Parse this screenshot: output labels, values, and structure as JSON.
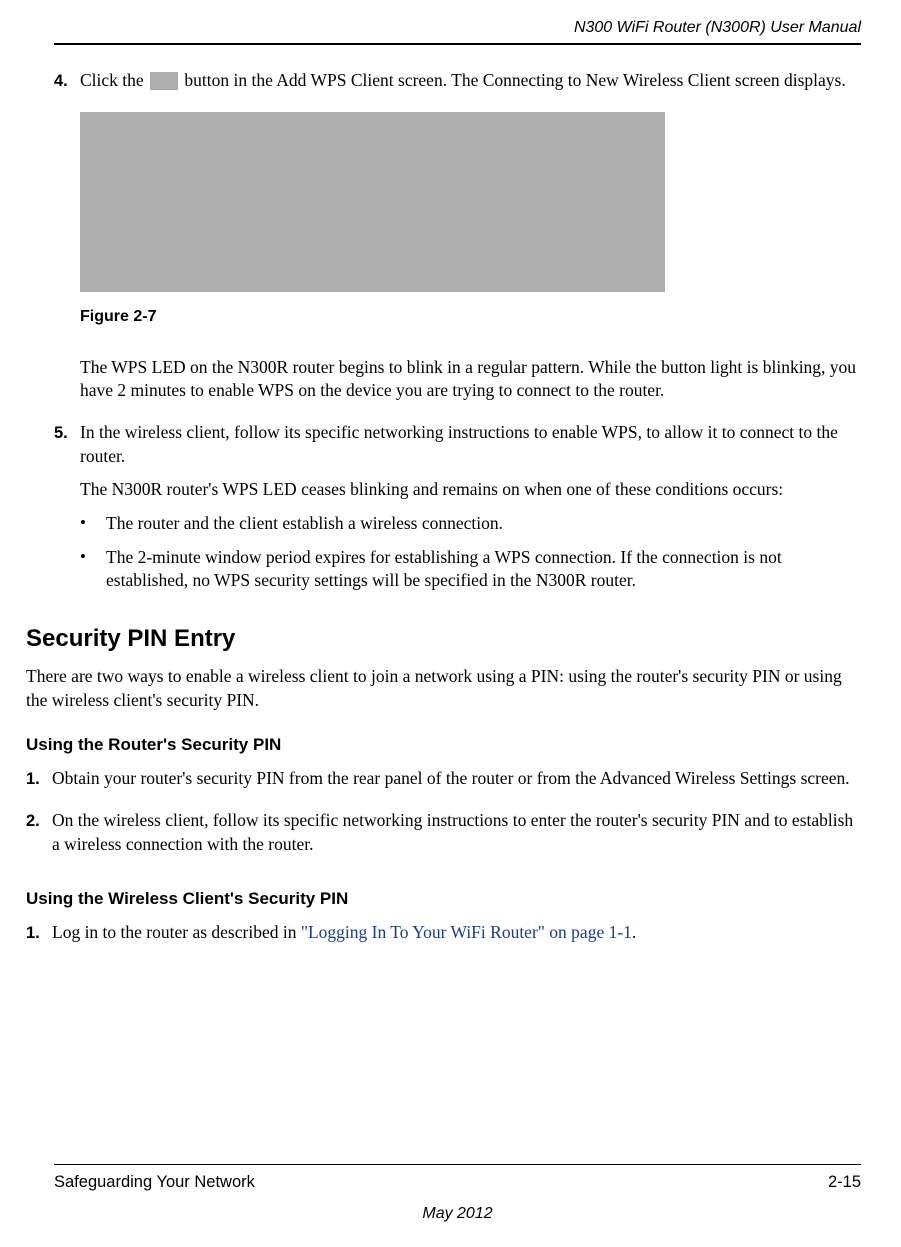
{
  "header": {
    "title": "N300 WiFi Router (N300R) User Manual"
  },
  "step4": {
    "num": "4.",
    "text_a": "Click the ",
    "text_b": " button in the Add WPS Client screen. The Connecting to New Wireless Client screen displays.",
    "figure_caption": "Figure 2-7",
    "wps_para": "The WPS LED on the N300R router begins to blink in a regular pattern. While the button light is blinking, you have 2 minutes to enable WPS on the device you are trying to connect to the router."
  },
  "step5": {
    "num": "5.",
    "para1": "In the wireless client, follow its specific networking instructions to enable WPS, to allow it to connect to the router.",
    "para2": "The N300R router's WPS LED ceases blinking and remains on when one of these conditions occurs:",
    "bullets": [
      "The router and the client establish a wireless connection.",
      "The 2-minute window period expires for establishing a WPS connection. If the connection is not established, no WPS security settings will be specified in the N300R router."
    ]
  },
  "section": {
    "title": "Security PIN Entry",
    "intro": "There are two ways to enable a wireless client to join a network using a PIN: using the router's security PIN or using the wireless client's security PIN."
  },
  "sub1": {
    "title": "Using the Router's Security PIN",
    "steps": [
      {
        "num": "1.",
        "text": "Obtain your router's security PIN from the rear panel of the router or from the Advanced Wireless Settings screen."
      },
      {
        "num": "2.",
        "text": "On the wireless client, follow its specific networking instructions to enter the router's security PIN and to establish a wireless connection with the router."
      }
    ]
  },
  "sub2": {
    "title": "Using the Wireless Client's Security PIN",
    "step1": {
      "num": "1.",
      "pre": "Log in to the router as described in ",
      "link": "\"Logging In To Your WiFi Router\" on page 1-1",
      "post": "."
    }
  },
  "footer": {
    "left": "Safeguarding Your Network",
    "right": "2-15",
    "date": "May 2012"
  }
}
